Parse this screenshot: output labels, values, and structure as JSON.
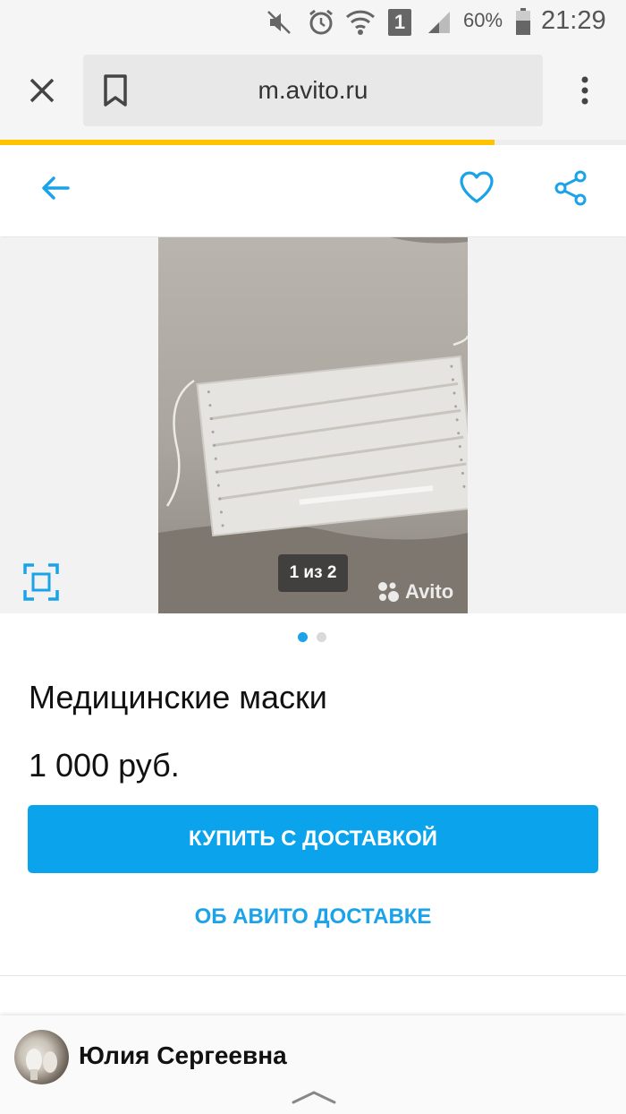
{
  "status_bar": {
    "battery": "60%",
    "clock": "21:29",
    "sim_label": "1",
    "icons": [
      "mute-icon",
      "alarm-icon",
      "wifi-icon",
      "sim-icon",
      "signal-icon",
      "battery-icon"
    ]
  },
  "browser": {
    "url": "m.avito.ru",
    "load_progress": 0.79
  },
  "colors": {
    "accent": "#0ba4ec",
    "link": "#1aa3e8",
    "progress": "#ffc300",
    "dot_active": "#1aa3e8",
    "dot_inactive": "#d9d9d9"
  },
  "gallery": {
    "counter": "1 из 2",
    "watermark": "Avito",
    "total_images": 2,
    "active_index": 0
  },
  "listing": {
    "title": "Медицинские маски",
    "price": "1 000 руб."
  },
  "actions": {
    "buy_label": "КУПИТЬ С ДОСТАВКОЙ",
    "about_delivery_label": "ОБ АВИТО ДОСТАВКЕ"
  },
  "seller": {
    "name": "Юлия Сергеевна"
  }
}
